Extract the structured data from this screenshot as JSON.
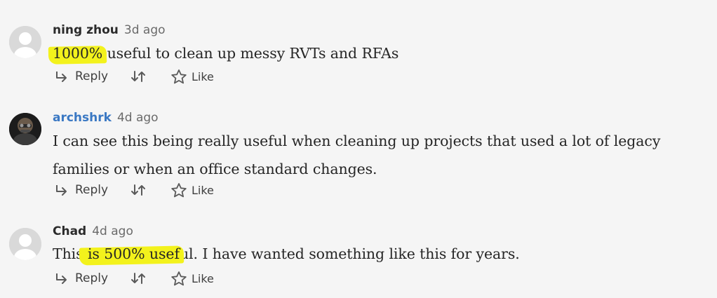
{
  "comments": [
    {
      "author": "ning zhou",
      "time": "3d ago",
      "highlight_pre": "",
      "highlight": "1000%",
      "text_post": " useful to clean up messy RVTs and RFAs",
      "reply_label": "Reply",
      "like_label": "Like"
    },
    {
      "author": "archshrk",
      "time": "4d ago",
      "text": "I can see this being really useful when cleaning up projects that used a lot of legacy families or when an office standard changes.",
      "reply_label": "Reply",
      "like_label": "Like"
    },
    {
      "author": "Chad",
      "time": "4d ago",
      "highlight_pre": "This",
      "highlight": " is 500% usef",
      "text_post": "ul. I have wanted something like this for years.",
      "reply_label": "Reply",
      "like_label": "Like"
    }
  ],
  "colors": {
    "background": "#f5f5f5",
    "author_link": "#3a78c3",
    "highlight": "#f3f21c"
  }
}
